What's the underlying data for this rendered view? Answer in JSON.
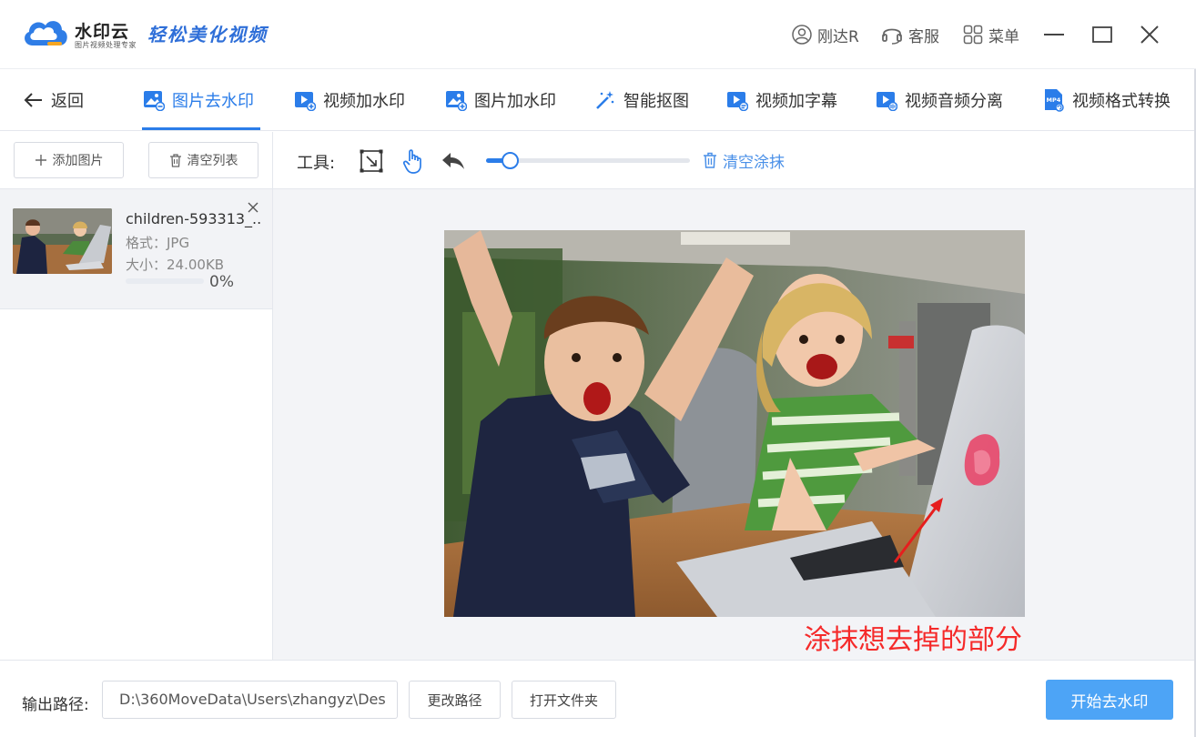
{
  "app": {
    "brand": "水印云",
    "brand_sub": "图片视频处理专家",
    "slogan": "轻松美化视频",
    "colors": {
      "accent": "#2b7de9",
      "primary_button": "#4da4f6",
      "annotation": "#f52a2a"
    }
  },
  "titlebar": {
    "user": "刚达R",
    "service": "客服",
    "menu": "菜单",
    "icons": [
      "user-icon",
      "headset-icon",
      "grid-menu-icon",
      "minimize-icon",
      "maximize-icon",
      "close-icon"
    ]
  },
  "nav": {
    "back": "返回",
    "tabs": [
      {
        "label": "图片去水印",
        "icon": "image-remove-icon",
        "active": true
      },
      {
        "label": "视频加水印",
        "icon": "video-add-icon",
        "active": false
      },
      {
        "label": "图片加水印",
        "icon": "image-add-icon",
        "active": false
      },
      {
        "label": "智能抠图",
        "icon": "magic-wand-icon",
        "active": false
      },
      {
        "label": "视频加字幕",
        "icon": "video-subtitle-icon",
        "active": false
      },
      {
        "label": "视频音频分离",
        "icon": "video-audio-icon",
        "active": false
      },
      {
        "label": "视频格式转换",
        "icon": "mp4-file-icon",
        "active": false
      }
    ]
  },
  "left_panel": {
    "add_label": "添加图片",
    "clear_label": "清空列表",
    "files": [
      {
        "name": "children-593313_...",
        "format": "格式：JPG",
        "size": "大小：24.00KB",
        "progress_text": "0%",
        "progress": 0
      }
    ]
  },
  "toolbar": {
    "label": "工具:",
    "tools": [
      "select-box-icon",
      "hand-pointer-icon",
      "undo-icon"
    ],
    "brush_size": 0.11,
    "clear_label": "清空涂抹"
  },
  "canvas": {
    "annotation": "涂抹想去掉的部分"
  },
  "bottom": {
    "output_label": "输出路径:",
    "path": "D:\\360MoveData\\Users\\zhangyz\\Des",
    "change_path": "更改路径",
    "open_folder": "打开文件夹",
    "start": "开始去水印"
  }
}
